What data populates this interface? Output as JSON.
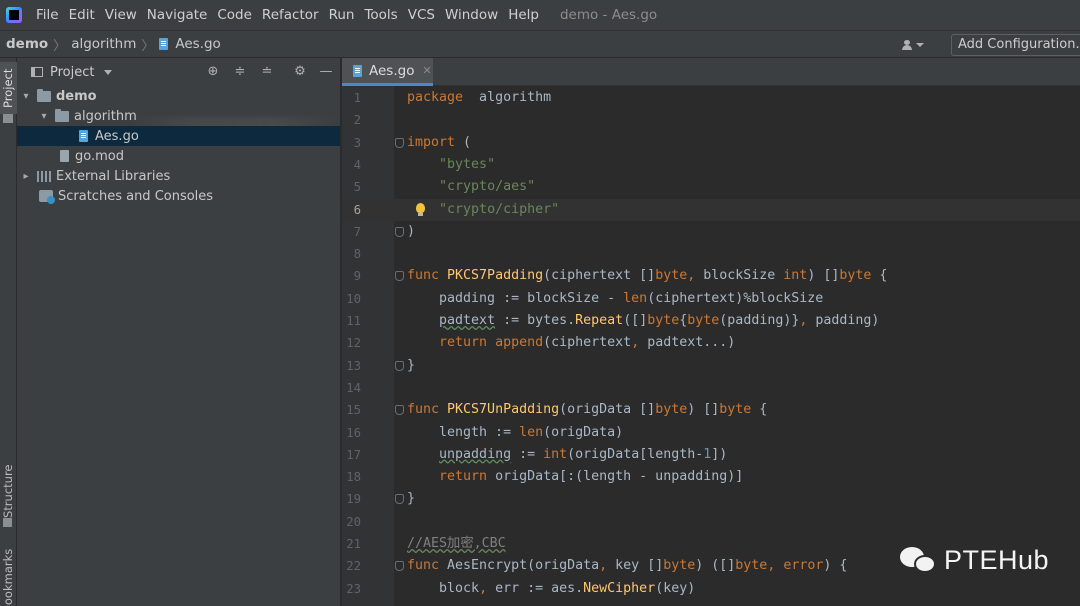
{
  "menubar": {
    "items": [
      "File",
      "Edit",
      "View",
      "Navigate",
      "Code",
      "Refactor",
      "Run",
      "Tools",
      "VCS",
      "Window",
      "Help"
    ],
    "window_title": "demo - Aes.go"
  },
  "navbar": {
    "breadcrumbs": [
      "demo",
      "algorithm",
      "Aes.go"
    ],
    "add_configuration": "Add Configuration..."
  },
  "tool_strip": {
    "project": "Project",
    "structure": "Structure",
    "bookmarks": "Bookmarks"
  },
  "project_panel": {
    "title": "Project",
    "tree": [
      {
        "label": "demo",
        "depth": 0,
        "expanded": true,
        "kind": "folder"
      },
      {
        "label": "algorithm",
        "depth": 1,
        "expanded": true,
        "kind": "folder"
      },
      {
        "label": "Aes.go",
        "depth": 2,
        "kind": "go-file",
        "selected": true
      },
      {
        "label": "go.mod",
        "depth": 1,
        "kind": "mod-file"
      },
      {
        "label": "External Libraries",
        "depth": 0,
        "expanded": false,
        "kind": "libraries"
      },
      {
        "label": "Scratches and Consoles",
        "depth": 0,
        "kind": "scratches"
      }
    ]
  },
  "editor": {
    "tab": "Aes.go",
    "current_line": 6,
    "lines": [
      {
        "n": "1",
        "tokens": [
          [
            "kw",
            "package"
          ],
          [
            "",
            "  algorithm"
          ]
        ]
      },
      {
        "n": "2",
        "tokens": []
      },
      {
        "n": "3",
        "tokens": [
          [
            "kw",
            "import"
          ],
          [
            "",
            " ("
          ]
        ],
        "fold": true
      },
      {
        "n": "4",
        "tokens": [
          [
            "",
            "    "
          ],
          [
            "str",
            "\"bytes\""
          ]
        ]
      },
      {
        "n": "5",
        "tokens": [
          [
            "",
            "    "
          ],
          [
            "str",
            "\"crypto/aes\""
          ]
        ]
      },
      {
        "n": "6",
        "tokens": [
          [
            "",
            "    "
          ],
          [
            "str",
            "\"crypto/cipher\""
          ]
        ],
        "bulb": true
      },
      {
        "n": "7",
        "tokens": [
          [
            "",
            ")"
          ]
        ],
        "fold": true
      },
      {
        "n": "8",
        "tokens": []
      },
      {
        "n": "9",
        "tokens": [
          [
            "kw",
            "func "
          ],
          [
            "fn",
            "PKCS7Padding"
          ],
          [
            "",
            "(ciphertext []"
          ],
          [
            "kw",
            "byte"
          ],
          [
            "kw",
            ", "
          ],
          [
            "",
            "blockSize "
          ],
          [
            "kw",
            "int"
          ],
          [
            "",
            ") []"
          ],
          [
            "kw",
            "byte"
          ],
          [
            "",
            " {"
          ]
        ],
        "fold": true
      },
      {
        "n": "10",
        "tokens": [
          [
            "",
            "    padding := blockSize - "
          ],
          [
            "kw",
            "len"
          ],
          [
            "",
            "(ciphertext)%blockSize"
          ]
        ]
      },
      {
        "n": "11",
        "tokens": [
          [
            "",
            "    "
          ],
          [
            "un",
            "padtext"
          ],
          [
            "",
            " := bytes."
          ],
          [
            "fn",
            "Repeat"
          ],
          [
            "",
            "([]"
          ],
          [
            "kw",
            "byte"
          ],
          [
            "",
            "{"
          ],
          [
            "kw",
            "byte"
          ],
          [
            "",
            "(padding)}"
          ],
          [
            "kw",
            ", "
          ],
          [
            "",
            "padding)"
          ]
        ]
      },
      {
        "n": "12",
        "tokens": [
          [
            "",
            "    "
          ],
          [
            "kw",
            "return "
          ],
          [
            "kw",
            "append"
          ],
          [
            "",
            "(ciphertext"
          ],
          [
            "kw",
            ", "
          ],
          [
            "",
            "padtext...)"
          ]
        ]
      },
      {
        "n": "13",
        "tokens": [
          [
            "",
            "}"
          ]
        ],
        "fold": true
      },
      {
        "n": "14",
        "tokens": []
      },
      {
        "n": "15",
        "tokens": [
          [
            "kw",
            "func "
          ],
          [
            "fn",
            "PKCS7UnPadding"
          ],
          [
            "",
            "(origData []"
          ],
          [
            "kw",
            "byte"
          ],
          [
            "",
            ") []"
          ],
          [
            "kw",
            "byte"
          ],
          [
            "",
            " {"
          ]
        ],
        "fold": true
      },
      {
        "n": "16",
        "tokens": [
          [
            "",
            "    length := "
          ],
          [
            "kw",
            "len"
          ],
          [
            "",
            "(origData)"
          ]
        ]
      },
      {
        "n": "17",
        "tokens": [
          [
            "",
            "    "
          ],
          [
            "un",
            "unpadding"
          ],
          [
            "",
            " := "
          ],
          [
            "kw",
            "int"
          ],
          [
            "",
            "(origData[length-"
          ],
          [
            "num",
            "1"
          ],
          [
            "",
            "])"
          ]
        ]
      },
      {
        "n": "18",
        "tokens": [
          [
            "",
            "    "
          ],
          [
            "kw",
            "return "
          ],
          [
            "",
            "origData[:(length - unpadding)]"
          ]
        ]
      },
      {
        "n": "19",
        "tokens": [
          [
            "",
            "}"
          ]
        ],
        "fold": true
      },
      {
        "n": "20",
        "tokens": []
      },
      {
        "n": "21",
        "tokens": [
          [
            "cmt-u",
            "//AES加密,CBC"
          ]
        ]
      },
      {
        "n": "22",
        "tokens": [
          [
            "kw",
            "func "
          ],
          [
            "bi",
            "AesEncrypt"
          ],
          [
            "",
            "(origData"
          ],
          [
            "kw",
            ", "
          ],
          [
            "",
            "key []"
          ],
          [
            "kw",
            "byte"
          ],
          [
            "",
            ") ([]"
          ],
          [
            "kw",
            "byte"
          ],
          [
            "kw",
            ", "
          ],
          [
            "kw",
            "error"
          ],
          [
            "",
            ") {"
          ]
        ],
        "fold": true
      },
      {
        "n": "23",
        "tokens": [
          [
            "",
            "    block"
          ],
          [
            "kw",
            ", "
          ],
          [
            "",
            "err := aes."
          ],
          [
            "fn",
            "NewCipher"
          ],
          [
            "",
            "(key)"
          ]
        ]
      }
    ]
  },
  "watermark": {
    "text": "PTEHub",
    "icon": "wechat-icon"
  }
}
